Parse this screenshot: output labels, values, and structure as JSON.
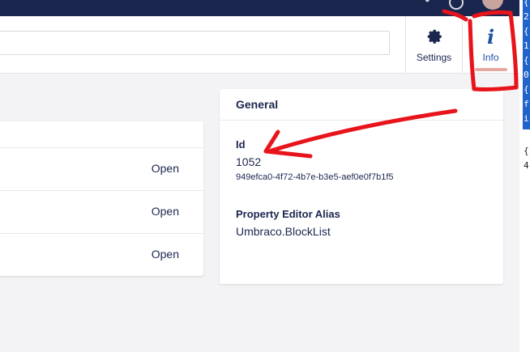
{
  "header": {
    "apps": [
      {
        "label": "Settings",
        "icon": "gear-icon"
      },
      {
        "label": "Info",
        "icon": "info-icon",
        "glyph": "i"
      }
    ]
  },
  "left_card": {
    "rows": [
      {
        "action": "Open"
      },
      {
        "action": "Open"
      },
      {
        "action": "Open"
      }
    ]
  },
  "general": {
    "title": "General",
    "id_label": "Id",
    "id_value": "1052",
    "key_value": "949efca0-4f72-4b7e-b3e5-aef0e0f7b1f5",
    "alias_label": "Property Editor Alias",
    "alias_value": "Umbraco.BlockList"
  },
  "code_strip": {
    "highlighted": [
      "{",
      "2",
      "{",
      "1",
      "{",
      "0",
      "{",
      "f",
      "i"
    ],
    "plain": [
      "{",
      "4"
    ]
  },
  "annotation_color": "#e8141c"
}
